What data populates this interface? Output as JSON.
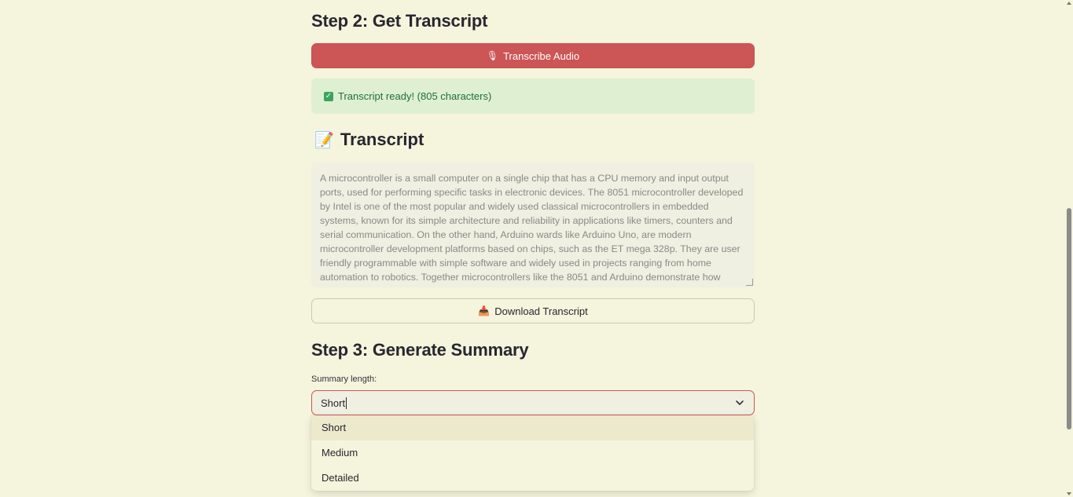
{
  "step2": {
    "title": "Step 2: Get Transcript",
    "transcribe_button": "Transcribe Audio",
    "success_message": "Transcript ready! (805 characters)"
  },
  "transcript_section": {
    "title": "Transcript",
    "text": "A microcontroller is a small computer on a single chip that has a CPU memory and input output ports, used for performing specific tasks in electronic devices. The 8051 microcontroller developed by Intel is one of the most popular and widely used classical microcontrollers in embedded systems, known for its simple architecture and reliability in applications like timers, counters and serial communication. On the other hand, Arduino wards like Arduino Uno, are modern microcontroller development platforms based on chips, such as the ET mega 328p. They are user friendly programmable with simple software and widely used in projects ranging from home automation to robotics. Together microcontrollers like the 8051 and Arduino demonstrate how these tiny chips form the backbone of modern...",
    "download_button": "Download Transcript"
  },
  "step3": {
    "title": "Step 3: Generate Summary",
    "length_label": "Summary length:",
    "selected_value": "Short",
    "options": [
      "Short",
      "Medium",
      "Detailed"
    ]
  },
  "icons": {
    "transcribe": "microphone-icon",
    "success": "check-icon",
    "transcript": "memo-icon",
    "download": "inbox-tray-icon",
    "select": "chevron-down-icon"
  },
  "colors": {
    "background": "#f5f4dc",
    "primary": "#cc5555",
    "success_bg": "#dfefd2",
    "success_text": "#1f6f3a"
  }
}
